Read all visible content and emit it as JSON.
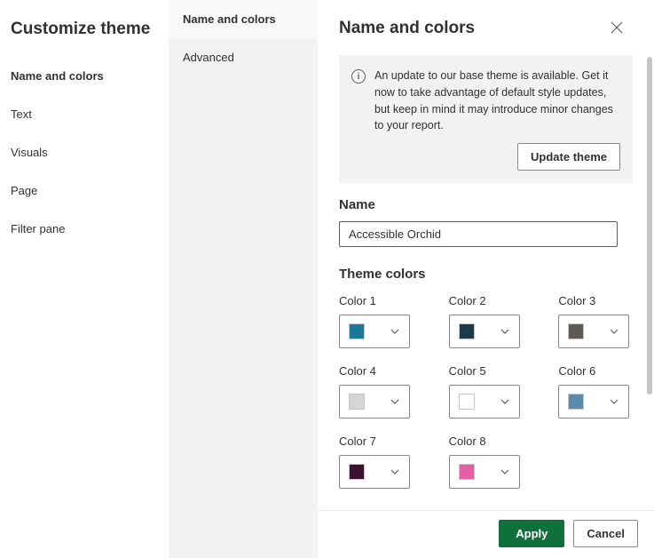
{
  "title": "Customize theme",
  "sidebar": {
    "items": [
      {
        "label": "Name and colors",
        "active": true
      },
      {
        "label": "Text",
        "active": false
      },
      {
        "label": "Visuals",
        "active": false
      },
      {
        "label": "Page",
        "active": false
      },
      {
        "label": "Filter pane",
        "active": false
      }
    ]
  },
  "subnav": {
    "items": [
      {
        "label": "Name and colors",
        "active": true
      },
      {
        "label": "Advanced",
        "active": false
      }
    ]
  },
  "panel": {
    "title": "Name and colors",
    "notice": {
      "text": "An update to our base theme is available. Get it now to take advantage of default style updates, but keep in mind it may introduce minor changes to your report.",
      "action_label": "Update theme"
    },
    "name_label": "Name",
    "name_value": "Accessible Orchid",
    "colors_title": "Theme colors",
    "colors": [
      {
        "label": "Color 1",
        "hex": "#1a7898"
      },
      {
        "label": "Color 2",
        "hex": "#1c3a4a"
      },
      {
        "label": "Color 3",
        "hex": "#5e5a54"
      },
      {
        "label": "Color 4",
        "hex": "#d6d4d4"
      },
      {
        "label": "Color 5",
        "hex": "#ffffff"
      },
      {
        "label": "Color 6",
        "hex": "#5a8bab"
      },
      {
        "label": "Color 7",
        "hex": "#3d1030"
      },
      {
        "label": "Color 8",
        "hex": "#e55ea6"
      }
    ]
  },
  "footer": {
    "apply_label": "Apply",
    "cancel_label": "Cancel"
  }
}
